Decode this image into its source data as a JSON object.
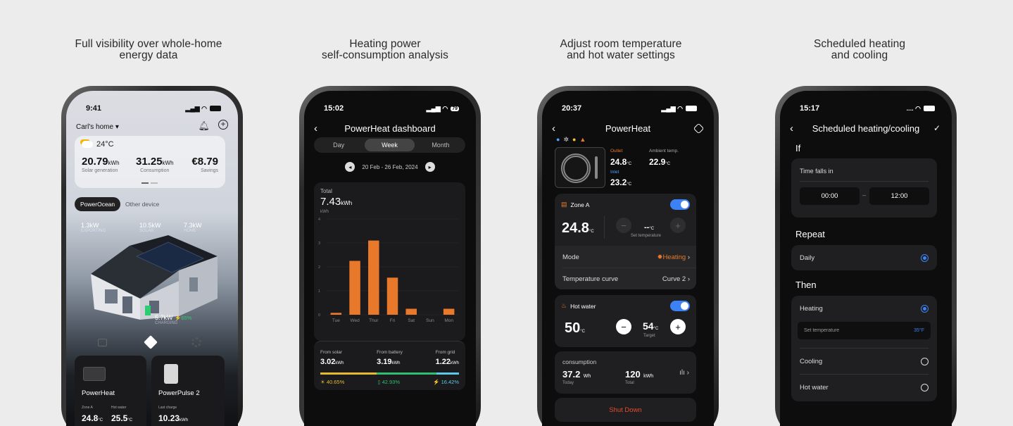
{
  "captions": [
    {
      "l1": "Full visibility over whole-home",
      "l2": "energy data"
    },
    {
      "l1": "Heating power",
      "l2": "self-consumption analysis"
    },
    {
      "l1": "Adjust room temperature",
      "l2": "and hot water settings"
    },
    {
      "l1": "Scheduled heating",
      "l2": "and cooling"
    }
  ],
  "p1": {
    "time": "9:41",
    "home": "Carl's home ▾",
    "weather": "24°C",
    "stats": [
      {
        "v": "20.79",
        "u": "kWh",
        "l": "Solar generation"
      },
      {
        "v": "31.25",
        "u": "kWh",
        "l": "Consumption"
      },
      {
        "v": "€8.79",
        "u": "",
        "l": "Savings"
      }
    ],
    "tabs": [
      "PowerOcean",
      "Other device"
    ],
    "flows": [
      {
        "v": "1.3kW",
        "l": "EXPORTING"
      },
      {
        "v": "10.5kW",
        "l": "SOLAR"
      },
      {
        "v": "7.3kW",
        "l": "HOME"
      }
    ],
    "battery": {
      "v": "5.7kW",
      "pct": "⚡65%",
      "l": "CHARGING"
    },
    "dev1": {
      "name": "PowerHeat",
      "a_l": "Zone A",
      "a_v": "24.8",
      "a_u": "°C",
      "b_l": "Hot water",
      "b_v": "25.5",
      "b_u": "°C"
    },
    "dev2": {
      "name": "PowerPulse 2",
      "a_l": "Last charge",
      "a_v": "10.23",
      "a_u": "kWh"
    }
  },
  "p2": {
    "time": "15:02",
    "title": "PowerHeat dashboard",
    "batt": "79",
    "tabs": [
      "Day",
      "Week",
      "Month"
    ],
    "range": "20 Feb - 26 Feb, 2024",
    "total_l": "Total",
    "total_v": "7.43",
    "total_u": "kWh",
    "unit": "kWh",
    "from": [
      {
        "l": "From solar",
        "v": "3.02",
        "u": "kWh",
        "p": "40.65%",
        "c": "#e6b92e"
      },
      {
        "l": "From battery",
        "v": "3.19",
        "u": "kWh",
        "p": "42.93%",
        "c": "#2fbf71"
      },
      {
        "l": "From grid",
        "v": "1.22",
        "u": "kWh",
        "p": "16.42%",
        "c": "#5bc8e6"
      }
    ]
  },
  "chart_data": {
    "type": "bar",
    "title": "",
    "xlabel": "",
    "ylabel": "kWh",
    "ylim": [
      0,
      4
    ],
    "yticks": [
      "0",
      "1",
      "2",
      "3",
      "4"
    ],
    "categories": [
      "Tue",
      "Wed",
      "Thur",
      "Fri",
      "Sat",
      "Sun",
      "Mon"
    ],
    "values": [
      0.08,
      2.25,
      3.1,
      1.55,
      0.25,
      0,
      0.25
    ],
    "color": "#e8792b",
    "grid": true
  },
  "p3": {
    "time": "20:37",
    "title": "PowerHeat",
    "outlet_l": "Outlet",
    "outlet_v": "24.8",
    "amb_l": "Ambient temp.",
    "amb_v": "22.9",
    "inlet_l": "Inlet",
    "inlet_v": "23.2",
    "deg": "°C",
    "zone": "Zone A",
    "zone_temp": "24.8",
    "set_v": "--",
    "set_l": "Set temperature",
    "mode_l": "Mode",
    "mode_v": "Heating",
    "curve_l": "Temperature curve",
    "curve_v": "Curve 2",
    "hw": "Hot water",
    "hw_temp": "50",
    "target_v": "54",
    "target_l": "Target",
    "cons_l": "consumption",
    "today_v": "37.2",
    "today_u": "Wh",
    "today_l": "Today",
    "total_v": "120",
    "total_u": "kWh",
    "total_l": "Total",
    "shut": "Shut Down"
  },
  "p4": {
    "time": "15:17",
    "title": "Scheduled heating/cooling",
    "if": "If",
    "time_l": "Time falls in",
    "from": "00:00",
    "dash": "–",
    "to": "12:00",
    "repeat": "Repeat",
    "daily": "Daily",
    "then": "Then",
    "heating": "Heating",
    "set_l": "Set temperature",
    "set_v": "35°F",
    "cooling": "Cooling",
    "hotwater": "Hot water"
  }
}
